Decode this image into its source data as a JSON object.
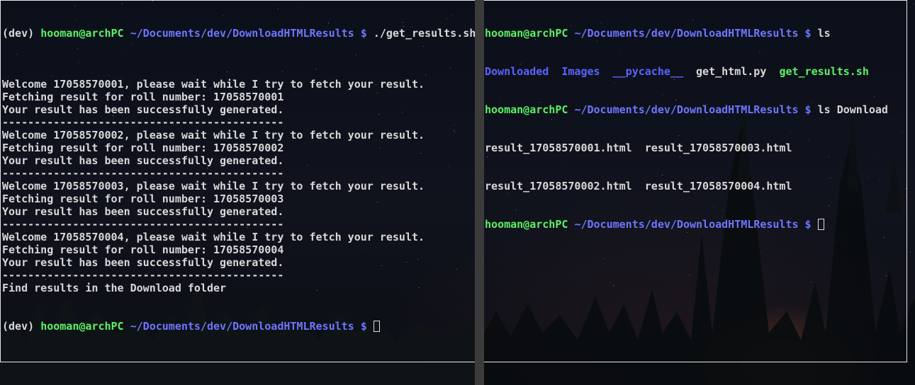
{
  "left_pane": {
    "prompt": {
      "env": "(dev) ",
      "user_host": "hooman@archPC",
      "path": "~/Documents/dev/DownloadHTMLResults",
      "symbol": "$"
    },
    "command": " ./get_results.sh",
    "output": [
      "",
      "Welcome 17058570001, please wait while I try to fetch your result.",
      "Fetching result for roll number: 17058570001",
      "Your result has been successfully generated.",
      "--------------------------------------------",
      "Welcome 17058570002, please wait while I try to fetch your result.",
      "Fetching result for roll number: 17058570002",
      "Your result has been successfully generated.",
      "--------------------------------------------",
      "Welcome 17058570003, please wait while I try to fetch your result.",
      "Fetching result for roll number: 17058570003",
      "Your result has been successfully generated.",
      "--------------------------------------------",
      "Welcome 17058570004, please wait while I try to fetch your result.",
      "Fetching result for roll number: 17058570004",
      "Your result has been successfully generated.",
      "--------------------------------------------",
      "Find results in the Download folder"
    ]
  },
  "right_pane": {
    "prompt": {
      "user_host": "hooman@archPC",
      "path": "~/Documents/dev/DownloadHTMLResults",
      "symbol": "$"
    },
    "command_1": " ls",
    "ls_entries": {
      "dir_1": "Downloaded",
      "dir_2": "Images",
      "dir_3": "__pycache__",
      "file_1": "get_html.py",
      "exe_1": "get_results.sh"
    },
    "command_2": " ls Download",
    "download_listing": [
      "result_17058570001.html  result_17058570003.html",
      "result_17058570002.html  result_17058570004.html"
    ]
  },
  "colors": {
    "prompt_user": "#5af263",
    "prompt_path": "#6f75ff",
    "directory": "#5b63ff",
    "executable": "#5af263",
    "text": "#d8d8d8"
  }
}
